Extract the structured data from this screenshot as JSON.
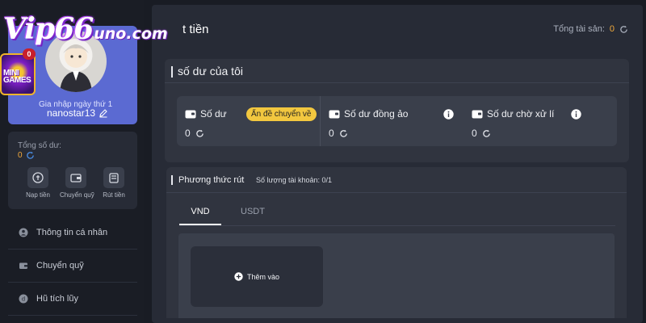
{
  "logo": {
    "brand": "Vip66",
    "domain": "uno.com"
  },
  "promo": {
    "badge_count": "0",
    "minigames_text": "MINI GAMES"
  },
  "profile": {
    "username": "nanostar13",
    "login_days": "Gia nhập ngày thứ 1"
  },
  "balance": {
    "label": "Tổng số dư:",
    "value": "0",
    "actions": [
      {
        "label": "Nạp tiền",
        "icon": "deposit-icon"
      },
      {
        "label": "Chuyển quỹ",
        "icon": "wallet-transfer-icon"
      },
      {
        "label": "Rút tiền",
        "icon": "withdraw-icon"
      }
    ]
  },
  "menu": [
    {
      "label": "Thông tin cá nhân",
      "icon": "user-icon"
    },
    {
      "label": "Chuyển quỹ",
      "icon": "wallet-icon"
    },
    {
      "label": "Hũ tích lũy",
      "icon": "jar-icon"
    }
  ],
  "header": {
    "title": "t tiền",
    "total_assets_label": "Tổng tài sản:",
    "total_assets_value": "0"
  },
  "wallet": {
    "title": "số dư của tôi",
    "balance_label": "Số dư",
    "balance_value": "0",
    "hide_button": "Ẩn đề chuyển về",
    "virtual_label": "Số dư đồng ảo",
    "virtual_value": "0",
    "pending_label": "Số dư chờ xử lí",
    "pending_value": "0"
  },
  "methods": {
    "title": "Phương thức rút",
    "account_count_label": "Số lượng tài khoản:",
    "account_count_value": "0/1",
    "tabs": [
      {
        "label": "VND",
        "active": true
      },
      {
        "label": "USDT",
        "active": false
      }
    ],
    "add_label": "Thêm vào"
  },
  "colors": {
    "accent_yellow": "#f2c73f",
    "value_orange": "#f2a93b",
    "profile_card": "#5b6ad2",
    "panel": "#272b36"
  }
}
